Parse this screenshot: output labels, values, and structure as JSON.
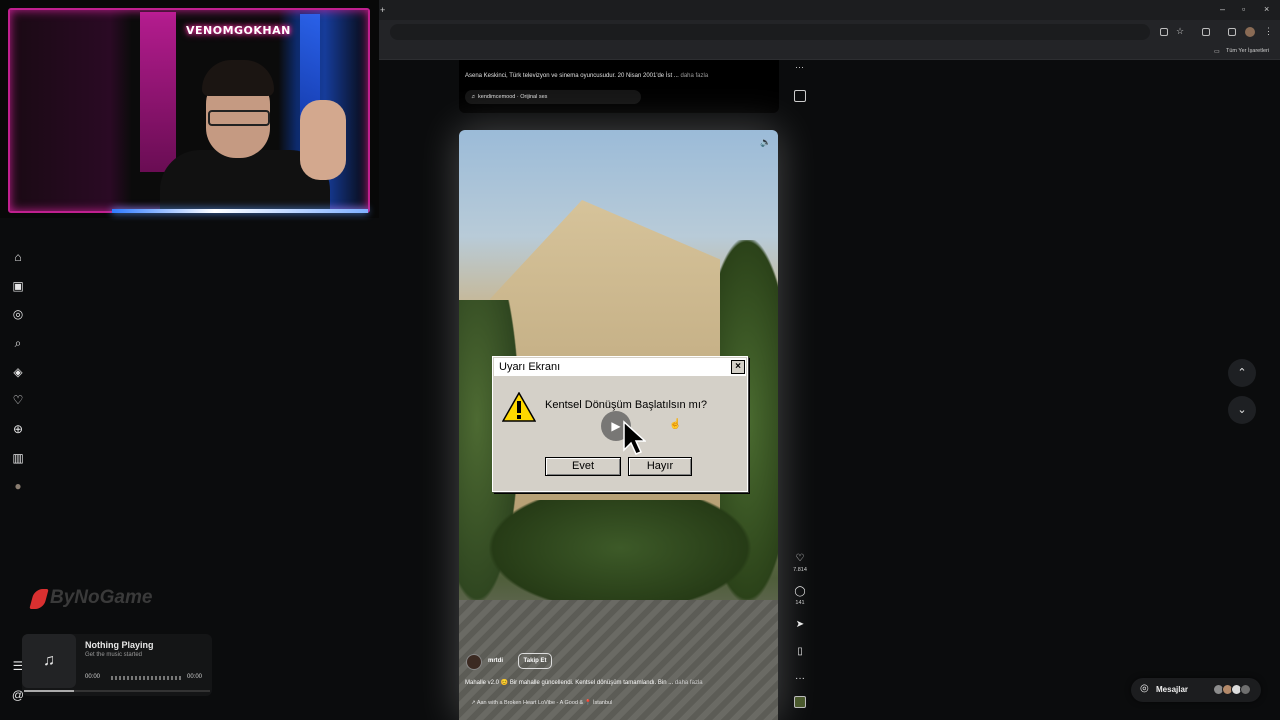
{
  "browser": {
    "new_tab": "+",
    "bookmarks_label": "Tüm Yer İşaretleri",
    "window_controls": [
      "–",
      "▫",
      "×"
    ]
  },
  "stream_overlay": {
    "streamer_name": "VENOMGOKHAN",
    "logo_text": "ByNoGame"
  },
  "left_nav": {
    "items": [
      {
        "icon": "home-icon",
        "glyph": "⌂"
      },
      {
        "icon": "reels-icon",
        "glyph": "▣"
      },
      {
        "icon": "messenger-icon",
        "glyph": "◎"
      },
      {
        "icon": "search-icon",
        "glyph": "⌕"
      },
      {
        "icon": "explore-icon",
        "glyph": "◈"
      },
      {
        "icon": "heart-icon",
        "glyph": "♡"
      },
      {
        "icon": "create-icon",
        "glyph": "⊕"
      },
      {
        "icon": "insights-icon",
        "glyph": "▥"
      },
      {
        "icon": "profile-avatar",
        "glyph": "●"
      }
    ],
    "menu_glyph": "☰",
    "threads_glyph": "@"
  },
  "music_widget": {
    "title": "Nothing Playing",
    "subtitle": "Get the music started",
    "time_start": "00:00",
    "time_end": "00:00",
    "icon": "♫"
  },
  "previous_reel": {
    "description": "Asena Keskinci, Türk televizyon ve sinema oyuncusudur. 20 Nisan 2001'de İst ...",
    "more": "daha fazla",
    "audio": "♬ kendimcemood · Orijinal ses"
  },
  "dialog": {
    "title": "Uyarı Ekranı",
    "close": "×",
    "message": "Kentsel Dönüşüm Başlatılsın mı?",
    "yes_label": "Evet",
    "no_label": "Hayır"
  },
  "reel": {
    "username": "mrtdi",
    "follow_label": "Takip Et",
    "caption": "Mahalle v2.0 😊 Bir mahalle güncellendi. Kentsel dönüşüm tamamlandı. Bin ...",
    "more": "daha fazla",
    "audio": "↗ Aan with a Broken Heart    LoVibe - A Good &    📍 İstanbul"
  },
  "actions": {
    "likes": "7.814",
    "comments": "141"
  },
  "messages_button": {
    "label": "Mesajlar"
  },
  "colors": {
    "neon_pink": "#c0208f",
    "neon_blue": "#2f7bff",
    "dialog_bg": "#d4d0c8",
    "page_bg": "#0b0c0d"
  }
}
